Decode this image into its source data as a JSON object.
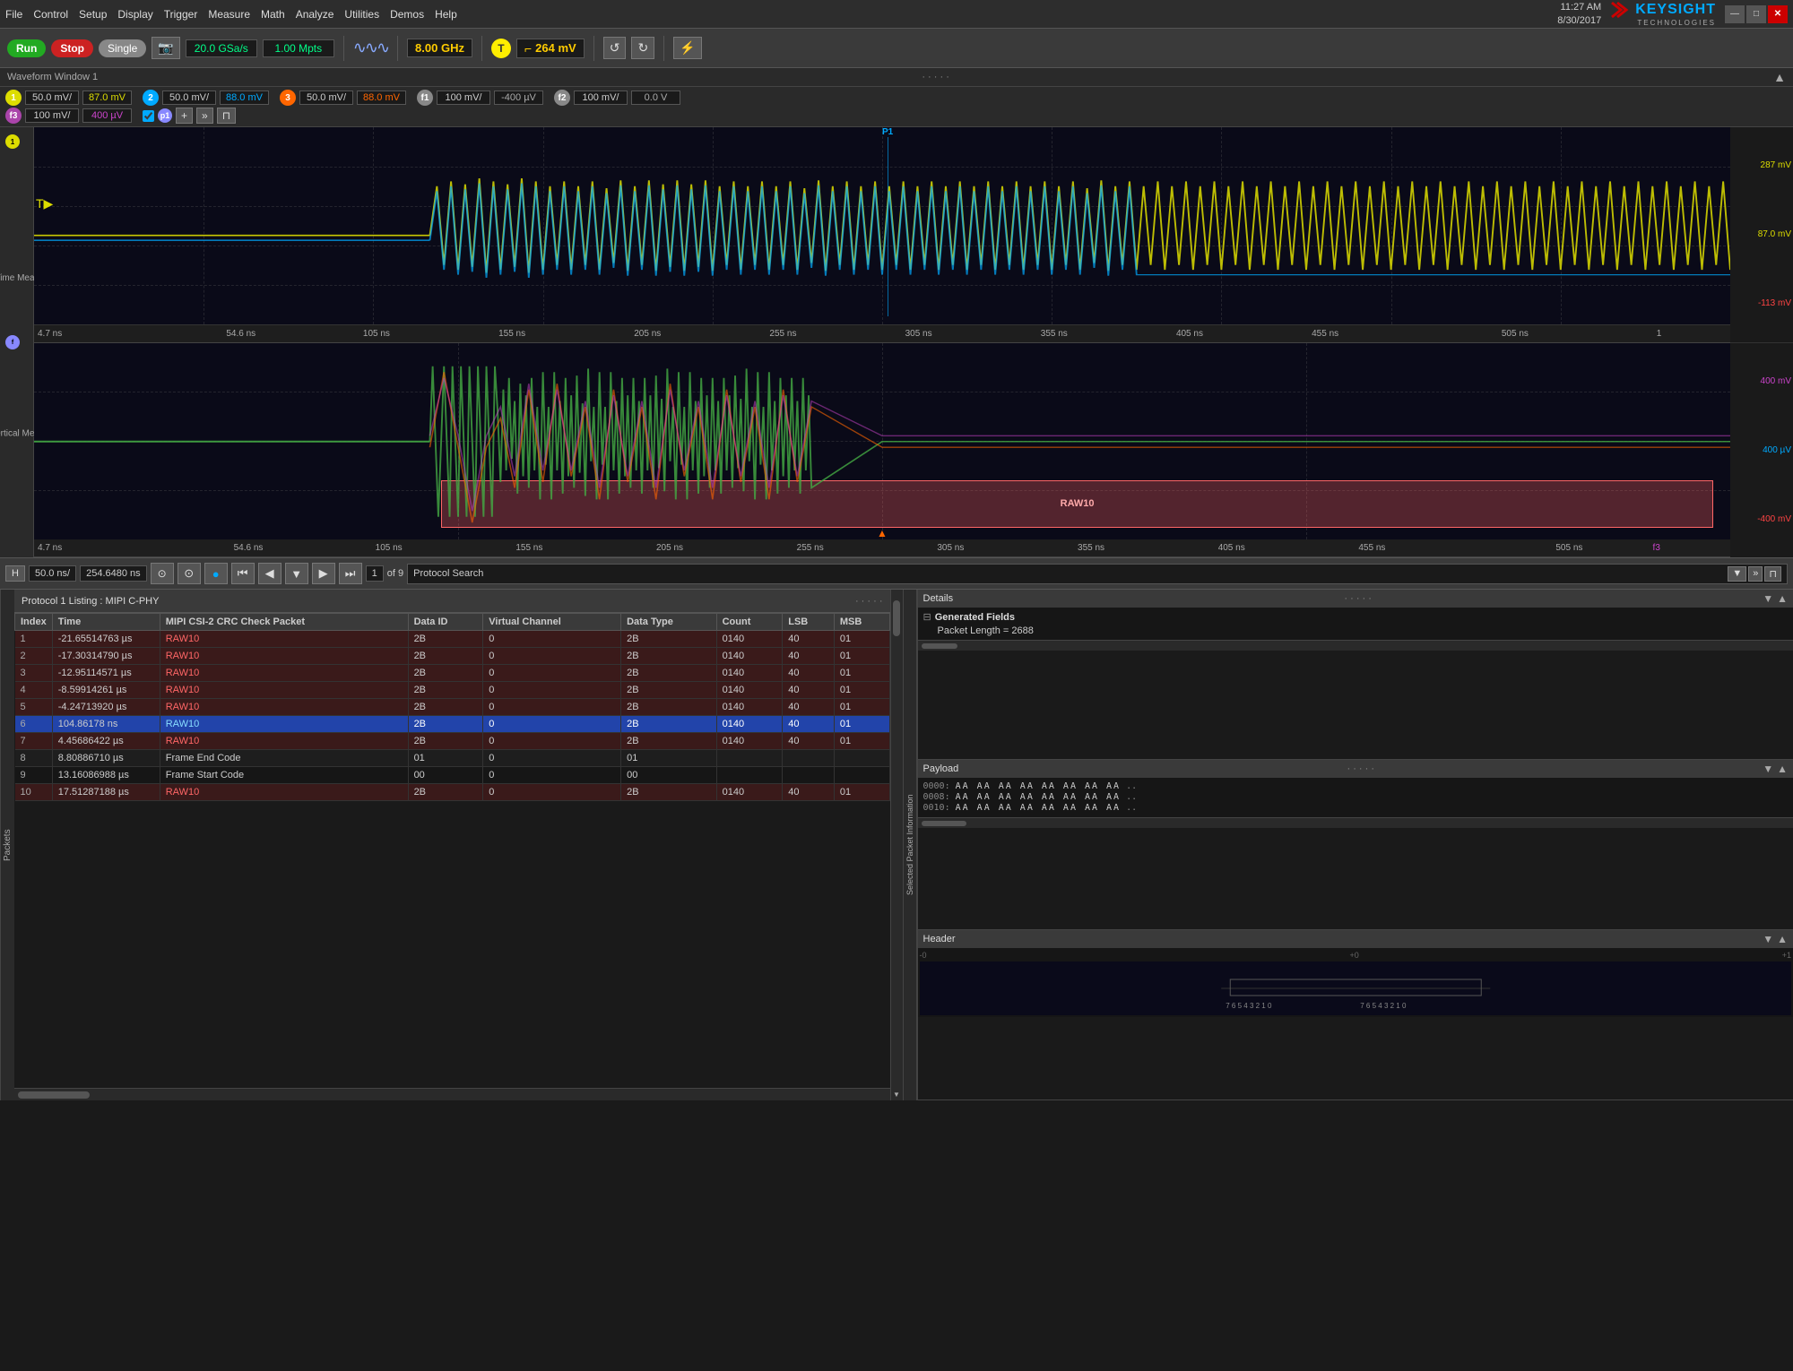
{
  "titlebar": {
    "menu_items": [
      "File",
      "Control",
      "Setup",
      "Display",
      "Trigger",
      "Measure",
      "Math",
      "Analyze",
      "Utilities",
      "Demos",
      "Help"
    ],
    "datetime": "11:27 AM\n8/30/2017",
    "brand": "KEYSIGHT",
    "brand_sub": "TECHNOLOGIES"
  },
  "toolbar": {
    "run_label": "Run",
    "stop_label": "Stop",
    "single_label": "Single",
    "sample_rate": "20.0 GSa/s",
    "memory": "1.00 Mpts",
    "freq": "8.00 GHz",
    "trig_level": "264 mV"
  },
  "window_label": "Waveform Window 1",
  "channels": {
    "ch1": {
      "scale": "50.0 mV/",
      "offset": "87.0 mV",
      "badge": "1"
    },
    "ch2": {
      "scale": "50.0 mV/",
      "offset": "88.0 mV",
      "badge": "2"
    },
    "ch3": {
      "scale": "50.0 mV/",
      "offset": "88.0 mV",
      "badge": "3"
    },
    "f1": {
      "scale": "100 mV/",
      "offset": "-400 µV",
      "badge": "f1"
    },
    "f2": {
      "scale": "100 mV/",
      "offset": "0.0 V",
      "badge": "f2"
    },
    "f3": {
      "scale": "100 mV/",
      "offset": "400 µV",
      "badge": "f3"
    }
  },
  "waveform1": {
    "y_labels": [
      "287 mV",
      "87.0 mV",
      "-113 mV"
    ],
    "time_labels": [
      "4.7 ns",
      "54.6 ns",
      "105 ns",
      "155 ns",
      "205 ns",
      "255 ns",
      "305 ns",
      "355 ns",
      "405 ns",
      "455 ns",
      "505 ns"
    ],
    "p1_label": "P1",
    "channel_num": "1"
  },
  "waveform2": {
    "y_labels": [
      "400 mV",
      "400 µV",
      "-400 mV"
    ],
    "time_labels": [
      "4.7 ns",
      "54.6 ns",
      "105 ns",
      "155 ns",
      "205 ns",
      "255 ns",
      "305 ns",
      "355 ns",
      "405 ns",
      "455 ns",
      "505 ns"
    ],
    "raw10_label": "RAW10",
    "channel_num": "f3",
    "right_label": "f3"
  },
  "nav_bar": {
    "timebase": "H",
    "scale": "50.0 ns/",
    "position": "254.6480 ns",
    "lock_icon": "⊙",
    "nav_buttons": [
      "◀◀",
      "◀",
      "▼",
      "▶",
      "▶▶"
    ],
    "count": "1",
    "of_label": "of 9",
    "search_label": "Protocol Search",
    "zoom_icon": "⊕"
  },
  "protocol_listing": {
    "title": "Protocol 1 Listing : MIPI C-PHY",
    "columns": [
      "Index",
      "Time",
      "MIPI CSI-2 CRC Check Packet",
      "Data ID",
      "Virtual Channel",
      "Data Type",
      "Count",
      "LSB",
      "MSB"
    ],
    "rows": [
      {
        "index": "1",
        "time": "-21.65514763 µs",
        "packet": "RAW10",
        "data_id": "2B",
        "virtual_channel": "0",
        "data_type": "2B",
        "count": "0140",
        "lsb": "40",
        "msb": "01",
        "highlight": false,
        "raw10": true
      },
      {
        "index": "2",
        "time": "-17.30314790 µs",
        "packet": "RAW10",
        "data_id": "2B",
        "virtual_channel": "0",
        "data_type": "2B",
        "count": "0140",
        "lsb": "40",
        "msb": "01",
        "highlight": false,
        "raw10": true
      },
      {
        "index": "3",
        "time": "-12.95114571 µs",
        "packet": "RAW10",
        "data_id": "2B",
        "virtual_channel": "0",
        "data_type": "2B",
        "count": "0140",
        "lsb": "40",
        "msb": "01",
        "highlight": false,
        "raw10": true
      },
      {
        "index": "4",
        "time": "-8.59914261 µs",
        "packet": "RAW10",
        "data_id": "2B",
        "virtual_channel": "0",
        "data_type": "2B",
        "count": "0140",
        "lsb": "40",
        "msb": "01",
        "highlight": false,
        "raw10": true
      },
      {
        "index": "5",
        "time": "-4.24713920 µs",
        "packet": "RAW10",
        "data_id": "2B",
        "virtual_channel": "0",
        "data_type": "2B",
        "count": "0140",
        "lsb": "40",
        "msb": "01",
        "highlight": false,
        "raw10": true
      },
      {
        "index": "6",
        "time": "104.86178 ns",
        "packet": "RAW10",
        "data_id": "2B",
        "virtual_channel": "0",
        "data_type": "2B",
        "count": "0140",
        "lsb": "40",
        "msb": "01",
        "highlight": true,
        "raw10": true
      },
      {
        "index": "7",
        "time": "4.45686422 µs",
        "packet": "RAW10",
        "data_id": "2B",
        "virtual_channel": "0",
        "data_type": "2B",
        "count": "0140",
        "lsb": "40",
        "msb": "01",
        "highlight": false,
        "raw10": true
      },
      {
        "index": "8",
        "time": "8.80886710 µs",
        "packet": "Frame End Code",
        "data_id": "01",
        "virtual_channel": "0",
        "data_type": "01",
        "count": "",
        "lsb": "",
        "msb": "",
        "highlight": false,
        "raw10": false
      },
      {
        "index": "9",
        "time": "13.16086988 µs",
        "packet": "Frame Start Code",
        "data_id": "00",
        "virtual_channel": "0",
        "data_type": "00",
        "count": "",
        "lsb": "",
        "msb": "",
        "highlight": false,
        "raw10": false
      },
      {
        "index": "10",
        "time": "17.51287188 µs",
        "packet": "RAW10",
        "data_id": "2B",
        "virtual_channel": "0",
        "data_type": "2B",
        "count": "0140",
        "lsb": "40",
        "msb": "01",
        "highlight": false,
        "raw10": true
      }
    ]
  },
  "details_panel": {
    "title": "Details",
    "generated_fields_label": "Generated Fields",
    "packet_length_label": "Packet Length = 2688"
  },
  "payload_panel": {
    "title": "Payload",
    "rows": [
      {
        "addr": "0000:",
        "data": "AA AA AA AA AA AA AA AA",
        "dots": ".."
      },
      {
        "addr": "0008:",
        "data": "AA AA AA AA AA AA AA AA",
        "dots": ".."
      },
      {
        "addr": "0010:",
        "data": "AA AA AA AA AA AA AA AA",
        "dots": ".."
      }
    ]
  },
  "header_panel": {
    "title": "Header",
    "axis_labels": [
      "-0",
      "+0",
      "+1"
    ]
  }
}
